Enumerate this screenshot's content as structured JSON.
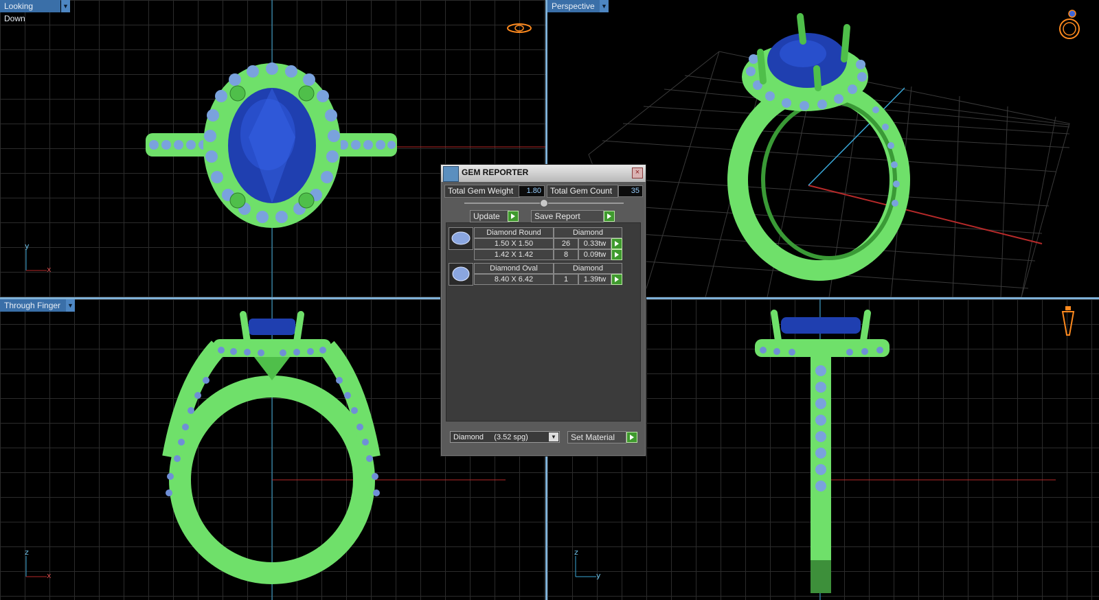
{
  "viewports": {
    "top_left": {
      "label": "Looking Down",
      "axis_v": "y",
      "axis_h": "x"
    },
    "top_right": {
      "label": "Perspective"
    },
    "bottom_left": {
      "label": "Through Finger",
      "axis_v": "z",
      "axis_h": "x"
    },
    "bottom_right": {
      "axis_v": "z",
      "axis_h": "y"
    }
  },
  "gem_reporter": {
    "title": "GEM REPORTER",
    "close_glyph": "×",
    "total_weight_label": "Total Gem Weight",
    "total_weight_value": "1.80",
    "total_count_label": "Total Gem Count",
    "total_count_value": "35",
    "update_label": "Update",
    "save_report_label": "Save Report",
    "groups": [
      {
        "name": "Diamond Round",
        "material": "Diamond",
        "rows": [
          {
            "size": "1.50 X 1.50",
            "count": "26",
            "weight": "0.33tw"
          },
          {
            "size": "1.42 X 1.42",
            "count": "8",
            "weight": "0.09tw"
          }
        ]
      },
      {
        "name": "Diamond Oval",
        "material": "Diamond",
        "rows": [
          {
            "size": "8.40 X 6.42",
            "count": "1",
            "weight": "1.39tw"
          }
        ]
      }
    ],
    "material_select": "Diamond     (3.52 spg)",
    "set_material_label": "Set Material"
  },
  "colors": {
    "metal": "#6fe06a",
    "center_stone": "#1f3fb0",
    "accent_stones": "#7aa2dd",
    "viewport_label_bg": "#3a6fa8",
    "divider": "#7fb1d8"
  },
  "icons": [
    "ring-top-icon",
    "ring-perspective-icon",
    "ring-side-icon",
    "dropdown-arrow-icon",
    "gem-reporter-icon",
    "close-icon",
    "play-arrow-icon",
    "round-gem-icon",
    "oval-gem-icon"
  ]
}
